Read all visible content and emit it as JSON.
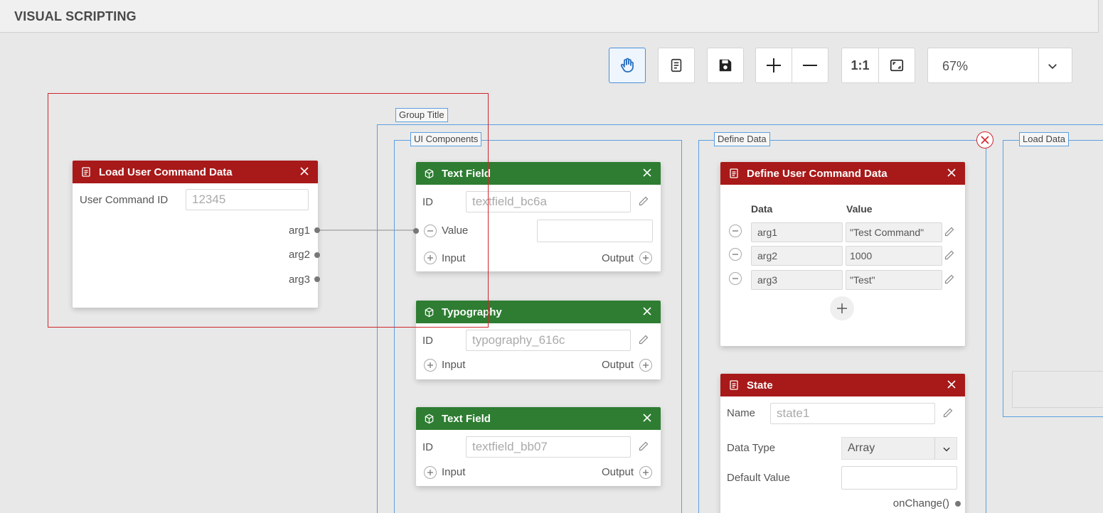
{
  "header": {
    "title": "VISUAL SCRIPTING"
  },
  "toolbar": {
    "pan_icon": "hand-icon",
    "doc_icon": "document-icon",
    "save_icon": "floppy-icon",
    "zoom_in_icon": "plus-icon",
    "zoom_out_icon": "minus-icon",
    "actual_size_label": "1:1",
    "fit_icon": "fit-screen-icon",
    "zoom_value": "67%"
  },
  "groups": {
    "outer_title": "Group Title",
    "ui_components": "UI Components",
    "define_data": "Define Data",
    "load_data": "Load Data"
  },
  "load_node": {
    "title": "Load User Command Data",
    "field_label": "User Command ID",
    "field_placeholder": "12345",
    "outputs": [
      "arg1",
      "arg2",
      "arg3"
    ]
  },
  "text_field_1": {
    "title": "Text Field",
    "id_label": "ID",
    "id_placeholder": "textfield_bc6a",
    "value_label": "Value",
    "input_label": "Input",
    "output_label": "Output"
  },
  "typography": {
    "title": "Typography",
    "id_label": "ID",
    "id_placeholder": "typography_616c",
    "input_label": "Input",
    "output_label": "Output"
  },
  "text_field_2": {
    "title": "Text Field",
    "id_label": "ID",
    "id_placeholder": "textfield_bb07",
    "input_label": "Input",
    "output_label": "Output"
  },
  "define_node": {
    "title": "Define User Command Data",
    "col_data": "Data",
    "col_value": "Value",
    "rows": [
      {
        "data": "arg1",
        "value": "\"Test Command\""
      },
      {
        "data": "arg2",
        "value": "1000"
      },
      {
        "data": "arg3",
        "value": "\"Test\""
      }
    ]
  },
  "state_node": {
    "title": "State",
    "name_label": "Name",
    "name_placeholder": "state1",
    "data_type_label": "Data Type",
    "data_type_value": "Array",
    "default_label": "Default Value",
    "on_change_label": "onChange()"
  },
  "colors": {
    "red_header": "#a81919",
    "green_header": "#2e7d32",
    "group_border": "#5aa0e0",
    "selection": "#d0262c"
  }
}
